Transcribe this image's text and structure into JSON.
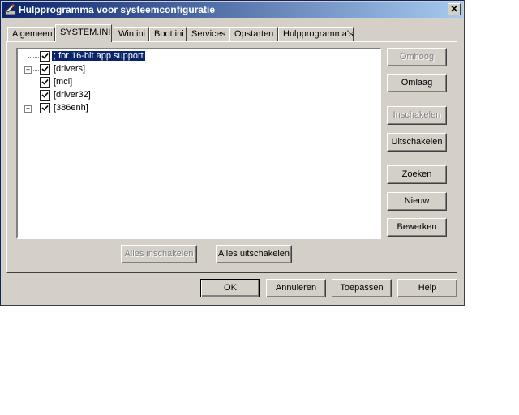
{
  "window": {
    "title": "Hulpprogramma voor systeemconfiguratie"
  },
  "tabs": [
    {
      "label": "Algemeen",
      "active": false
    },
    {
      "label": "SYSTEM.INI",
      "active": true
    },
    {
      "label": "Win.ini",
      "active": false
    },
    {
      "label": "Boot.ini",
      "active": false
    },
    {
      "label": "Services",
      "active": false
    },
    {
      "label": "Opstarten",
      "active": false
    },
    {
      "label": "Hulpprogramma's",
      "active": false
    }
  ],
  "tree": [
    {
      "label": "; for 16-bit app support",
      "checked": true,
      "expandable": false,
      "selected": true
    },
    {
      "label": "[drivers]",
      "checked": true,
      "expandable": true,
      "expander": "+"
    },
    {
      "label": "[mci]",
      "checked": true,
      "expandable": false
    },
    {
      "label": "[driver32]",
      "checked": true,
      "expandable": false
    },
    {
      "label": "[386enh]",
      "checked": true,
      "expandable": true,
      "expander": "+"
    }
  ],
  "side_buttons": {
    "move_up": "Omhoog",
    "move_down": "Omlaag",
    "enable": "Inschakelen",
    "disable": "Uitschakelen",
    "find": "Zoeken",
    "new": "Nieuw",
    "edit": "Bewerken"
  },
  "bottom_buttons": {
    "enable_all": "Alles inschakelen",
    "disable_all": "Alles uitschakelen"
  },
  "dialog_buttons": {
    "ok": "OK",
    "cancel": "Annuleren",
    "apply": "Toepassen",
    "help": "Help"
  },
  "close_glyph": "✕"
}
